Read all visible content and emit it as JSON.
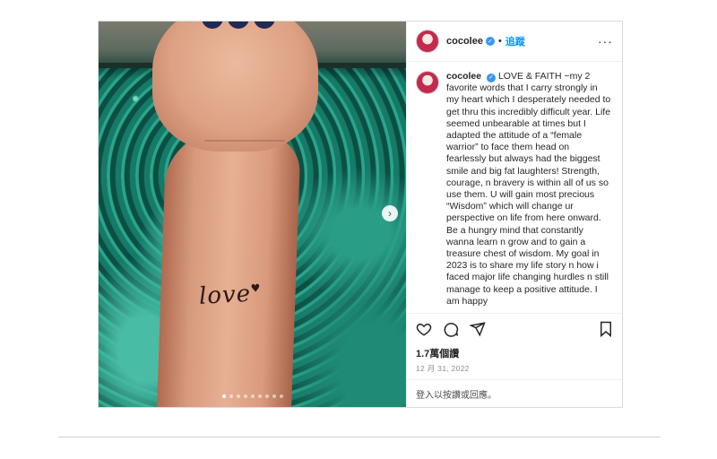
{
  "post": {
    "media": {
      "tattoo_text": "love",
      "tattoo_heart": "♥",
      "next_icon": "›",
      "carousel": {
        "total": 9,
        "active_index": 0
      }
    },
    "header": {
      "username": "cocolee",
      "verified_icon": "verified-badge-icon",
      "separator": "•",
      "follow_label": "追蹤",
      "more_label": "···"
    },
    "caption": {
      "username": "cocolee",
      "text": "LOVE & FAITH ~my 2 favorite words that I carry strongly in my heart which I desperately needed to get thru this incredibly difficult year. Life seemed unbearable at times but I adapted the attitude of a “female warrior” to face them head on fearlessly but always had the biggest smile and big fat laughters! Strength, courage, n bravery is within all of us so use them. U will gain most precious “Wisdom” which will change ur perspective on life from here onward. Be a hungry mind that constantly wanna learn n grow and to gain a treasure chest of wisdom. My goal in 2023 is to share my life story n how i faced major life changing hurdles n still manage to keep a positive attitude. I am happy"
    },
    "actions": {
      "like_icon": "heart-outline-icon",
      "comment_icon": "comment-icon",
      "share_icon": "send-icon",
      "save_icon": "bookmark-icon"
    },
    "stats": {
      "views": "1.7萬個讚",
      "date": "12 月 31, 2022"
    },
    "login_prompt": "登入以按讚或回應。"
  },
  "colors": {
    "accent": "#0095f6",
    "verified": "#3797f0",
    "border": "#dbdbdb"
  }
}
